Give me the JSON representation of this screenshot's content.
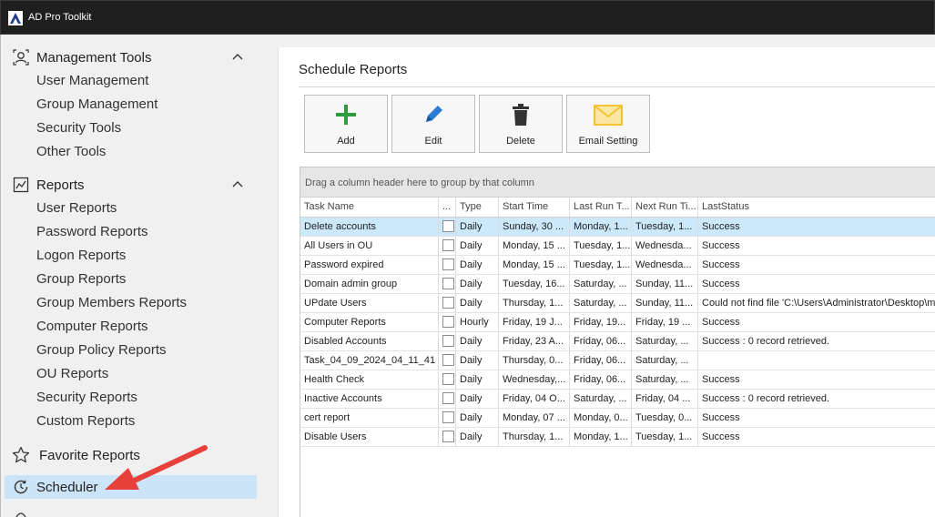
{
  "app": {
    "title": "AD Pro Toolkit"
  },
  "sidebar": {
    "management": {
      "title": "Management Tools",
      "items": [
        "User Management",
        "Group Management",
        "Security Tools",
        "Other Tools"
      ]
    },
    "reports": {
      "title": "Reports",
      "items": [
        "User Reports",
        "Password Reports",
        "Logon Reports",
        "Group Reports",
        "Group Members Reports",
        "Computer Reports",
        "Group Policy Reports",
        "OU Reports",
        "Security Reports",
        "Custom Reports"
      ]
    },
    "favorite": "Favorite Reports",
    "scheduler": "Scheduler"
  },
  "main": {
    "title": "Schedule Reports",
    "toolbar": {
      "add": "Add",
      "edit": "Edit",
      "delete": "Delete",
      "email": "Email Setting"
    },
    "grid": {
      "group_hint": "Drag a column header here to group by that column",
      "columns": [
        "Task Name",
        "...",
        "Type",
        "Start Time",
        "Last Run T...",
        "Next Run Ti...",
        "LastStatus"
      ],
      "rows": [
        {
          "name": "Delete accounts",
          "type": "Daily",
          "start": "Sunday, 30 ...",
          "last": "Monday, 1...",
          "next": "Tuesday, 1...",
          "status": "Success"
        },
        {
          "name": "All Users in OU",
          "type": "Daily",
          "start": "Monday, 15 ...",
          "last": "Tuesday, 1...",
          "next": "Wednesda...",
          "status": "Success"
        },
        {
          "name": "Password expired",
          "type": "Daily",
          "start": "Monday, 15 ...",
          "last": "Tuesday, 1...",
          "next": "Wednesda...",
          "status": "Success"
        },
        {
          "name": "Domain admin group",
          "type": "Daily",
          "start": "Tuesday, 16...",
          "last": "Saturday, ...",
          "next": "Sunday, 11...",
          "status": "Success"
        },
        {
          "name": "UPdate Users",
          "type": "Daily",
          "start": "Thursday, 1...",
          "last": "Saturday, ...",
          "next": "Sunday, 11...",
          "status": "Could not find file 'C:\\Users\\Administrator\\Desktop\\m"
        },
        {
          "name": "Computer Reports",
          "type": "Hourly",
          "start": "Friday, 19 J...",
          "last": "Friday, 19...",
          "next": "Friday, 19 ...",
          "status": "Success"
        },
        {
          "name": "Disabled Accounts",
          "type": "Daily",
          "start": "Friday, 23 A...",
          "last": "Friday, 06...",
          "next": "Saturday, ...",
          "status": "Success : 0 record retrieved."
        },
        {
          "name": "Task_04_09_2024_04_11_41",
          "type": "Daily",
          "start": "Thursday, 0...",
          "last": "Friday, 06...",
          "next": "Saturday, ...",
          "status": ""
        },
        {
          "name": "Health Check",
          "type": "Daily",
          "start": "Wednesday,...",
          "last": "Friday, 06...",
          "next": "Saturday, ...",
          "status": "Success"
        },
        {
          "name": "Inactive Accounts",
          "type": "Daily",
          "start": "Friday, 04 O...",
          "last": "Saturday, ...",
          "next": "Friday, 04 ...",
          "status": "Success : 0 record retrieved."
        },
        {
          "name": "cert report",
          "type": "Daily",
          "start": "Monday, 07 ...",
          "last": "Monday, 0...",
          "next": "Tuesday, 0...",
          "status": "Success"
        },
        {
          "name": "Disable Users",
          "type": "Daily",
          "start": "Thursday, 1...",
          "last": "Monday, 1...",
          "next": "Tuesday, 1...",
          "status": "Success"
        }
      ]
    }
  },
  "colors": {
    "selected_row": "#cce8fb",
    "scheduler_highlight": "#cce4f7",
    "arrow": "#e8413b",
    "add_icon": "#2e9c3e",
    "edit_icon": "#2b7cd3",
    "email_icon": "#f1c232"
  },
  "icons": {
    "management": "person-icon",
    "reports": "chart-icon",
    "favorite": "star-icon",
    "scheduler": "clock-icon"
  }
}
